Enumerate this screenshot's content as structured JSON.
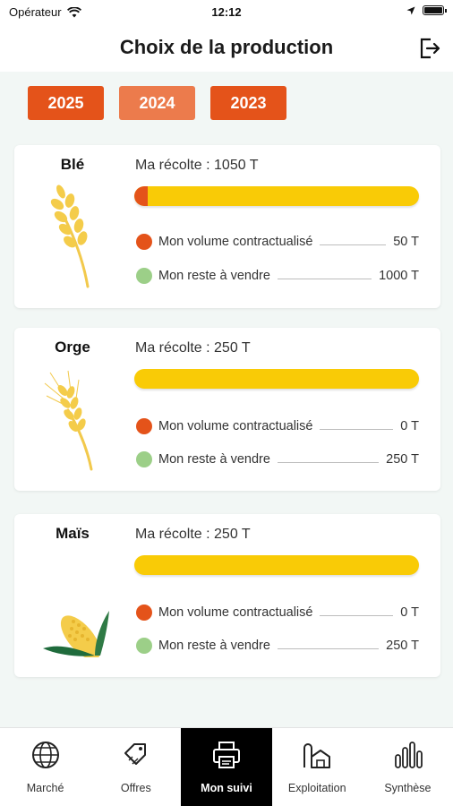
{
  "status_bar": {
    "carrier": "Opérateur",
    "time": "12:12"
  },
  "header": {
    "title": "Choix de la production"
  },
  "year_tabs": [
    {
      "label": "2025"
    },
    {
      "label": "2024"
    },
    {
      "label": "2023"
    }
  ],
  "crops": [
    {
      "name": "Blé",
      "harvest_label": "Ma récolte : 1050 T",
      "contracted_fraction": 0.048,
      "contracted_label": "Mon volume contractualisé",
      "contracted_value": "50 T",
      "remaining_label": "Mon reste à vendre",
      "remaining_value": "1000 T",
      "icon": "wheat-icon"
    },
    {
      "name": "Orge",
      "harvest_label": "Ma récolte : 250 T",
      "contracted_fraction": 0,
      "contracted_label": "Mon volume contractualisé",
      "contracted_value": "0 T",
      "remaining_label": "Mon reste à vendre",
      "remaining_value": "250 T",
      "icon": "barley-icon"
    },
    {
      "name": "Maïs",
      "harvest_label": "Ma récolte : 250 T",
      "contracted_fraction": 0,
      "contracted_label": "Mon volume contractualisé",
      "contracted_value": "0 T",
      "remaining_label": "Mon reste à vendre",
      "remaining_value": "250 T",
      "icon": "corn-icon"
    }
  ],
  "tabs": [
    {
      "label": "Marché",
      "icon": "globe-icon"
    },
    {
      "label": "Offres",
      "icon": "price-tag-icon"
    },
    {
      "label": "Mon suivi",
      "icon": "printer-icon",
      "active": true
    },
    {
      "label": "Exploitation",
      "icon": "farm-silo-icon"
    },
    {
      "label": "Synthèse",
      "icon": "bar-chart-icon"
    }
  ],
  "colors": {
    "accent": "#e4531a",
    "accent_light": "#ec7b4c",
    "harvest_bar": "#f9cb06",
    "remaining_dot": "#9ccf88"
  }
}
